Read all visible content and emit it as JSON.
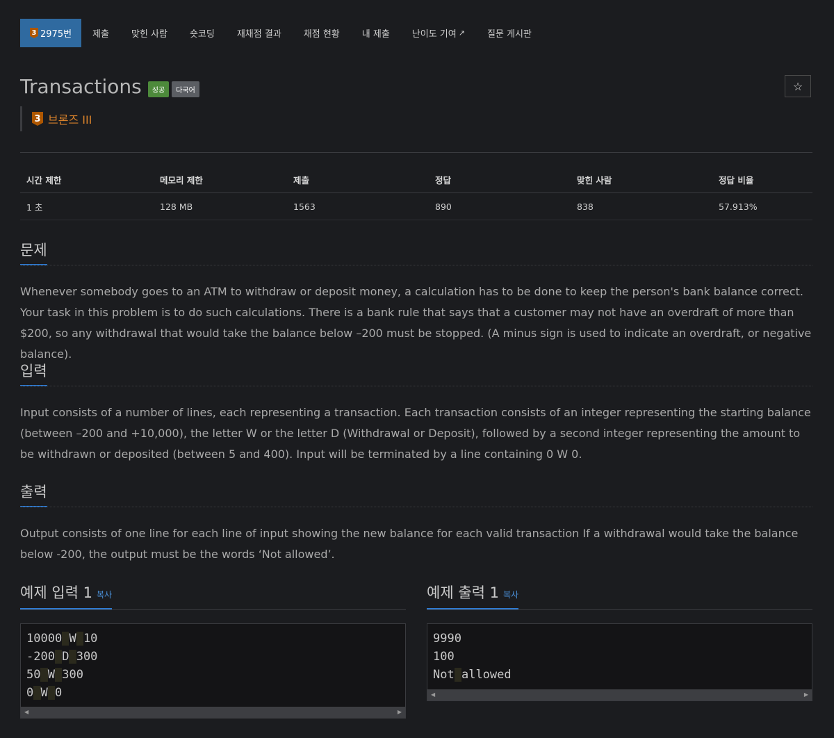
{
  "nav": {
    "problem_tier": "3",
    "problem_number": "2975번",
    "items": [
      "제출",
      "맞힌 사람",
      "숏코딩",
      "재채점 결과",
      "채점 현황",
      "내 제출",
      "난이도 기여",
      "질문 게시판"
    ]
  },
  "title": "Transactions",
  "labels": {
    "success": "성공",
    "multilang": "다국어"
  },
  "tier": {
    "number": "3",
    "name": "브론즈 III",
    "color": "#ad5600"
  },
  "info_table": {
    "headers": [
      "시간 제한",
      "메모리 제한",
      "제출",
      "정답",
      "맞힌 사람",
      "정답 비율"
    ],
    "values": [
      "1 초",
      "128 MB",
      "1563",
      "890",
      "838",
      "57.913%"
    ]
  },
  "sections": {
    "problem": {
      "heading": "문제",
      "text": "Whenever somebody goes to an ATM to withdraw or deposit money, a calculation has to be done to keep the person's bank balance correct. Your task in this problem is to do such calculations. There is a bank rule that says that a customer may not have an overdraft of more than $200, so any withdrawal that would take the balance below –200 must be stopped. (A minus sign is used to indicate an overdraft, or negative balance)."
    },
    "input": {
      "heading": "입력",
      "text": "Input consists of a number of lines, each representing a transaction. Each transaction consists of an integer representing the starting balance (between –200 and +10,000), the letter W or the letter D (Withdrawal or Deposit), followed by a second integer representing the amount to be withdrawn or deposited (between 5 and 400). Input will be terminated by a line containing 0 W 0."
    },
    "output": {
      "heading": "출력",
      "text": "Output consists of one line for each line of input showing the new balance for each valid transaction If a withdrawal would take the balance below -200, the output must be the words ‘Not allowed’."
    }
  },
  "samples": {
    "input": {
      "heading": "예제 입력 1",
      "copy": "복사",
      "lines": [
        [
          "10000",
          "W",
          "10"
        ],
        [
          "-200",
          "D",
          "300"
        ],
        [
          "50",
          "W",
          "300"
        ],
        [
          "0",
          "W",
          "0"
        ]
      ]
    },
    "output": {
      "heading": "예제 출력 1",
      "copy": "복사",
      "lines": [
        [
          "9990"
        ],
        [
          "100"
        ],
        [
          "Not",
          "allowed"
        ]
      ]
    }
  },
  "colors": {
    "accent": "#2f6aa0",
    "success": "#4d8a3b",
    "bronze": "#ad5600"
  }
}
